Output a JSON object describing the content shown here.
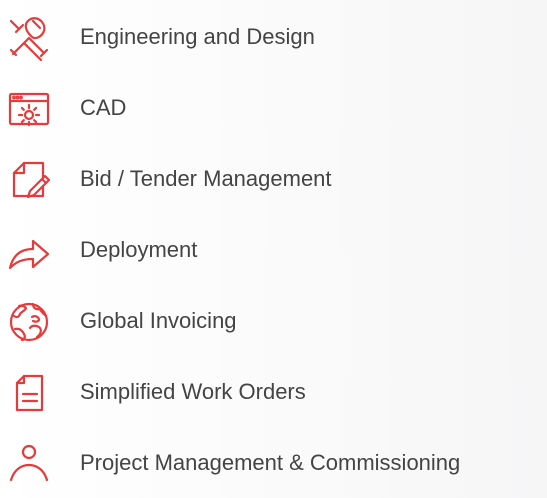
{
  "theme": {
    "icon_color": "#e53b3b",
    "text_color": "#444444"
  },
  "features": [
    {
      "label": "Engineering and Design",
      "icon": "tools-icon"
    },
    {
      "label": "CAD",
      "icon": "browser-gear-icon"
    },
    {
      "label": "Bid / Tender Management",
      "icon": "document-pen-icon"
    },
    {
      "label": "Deployment",
      "icon": "arrow-right-icon"
    },
    {
      "label": "Global Invoicing",
      "icon": "globe-icon"
    },
    {
      "label": "Simplified Work Orders",
      "icon": "document-lines-icon"
    },
    {
      "label": "Project Management & Commissioning",
      "icon": "user-icon"
    }
  ]
}
